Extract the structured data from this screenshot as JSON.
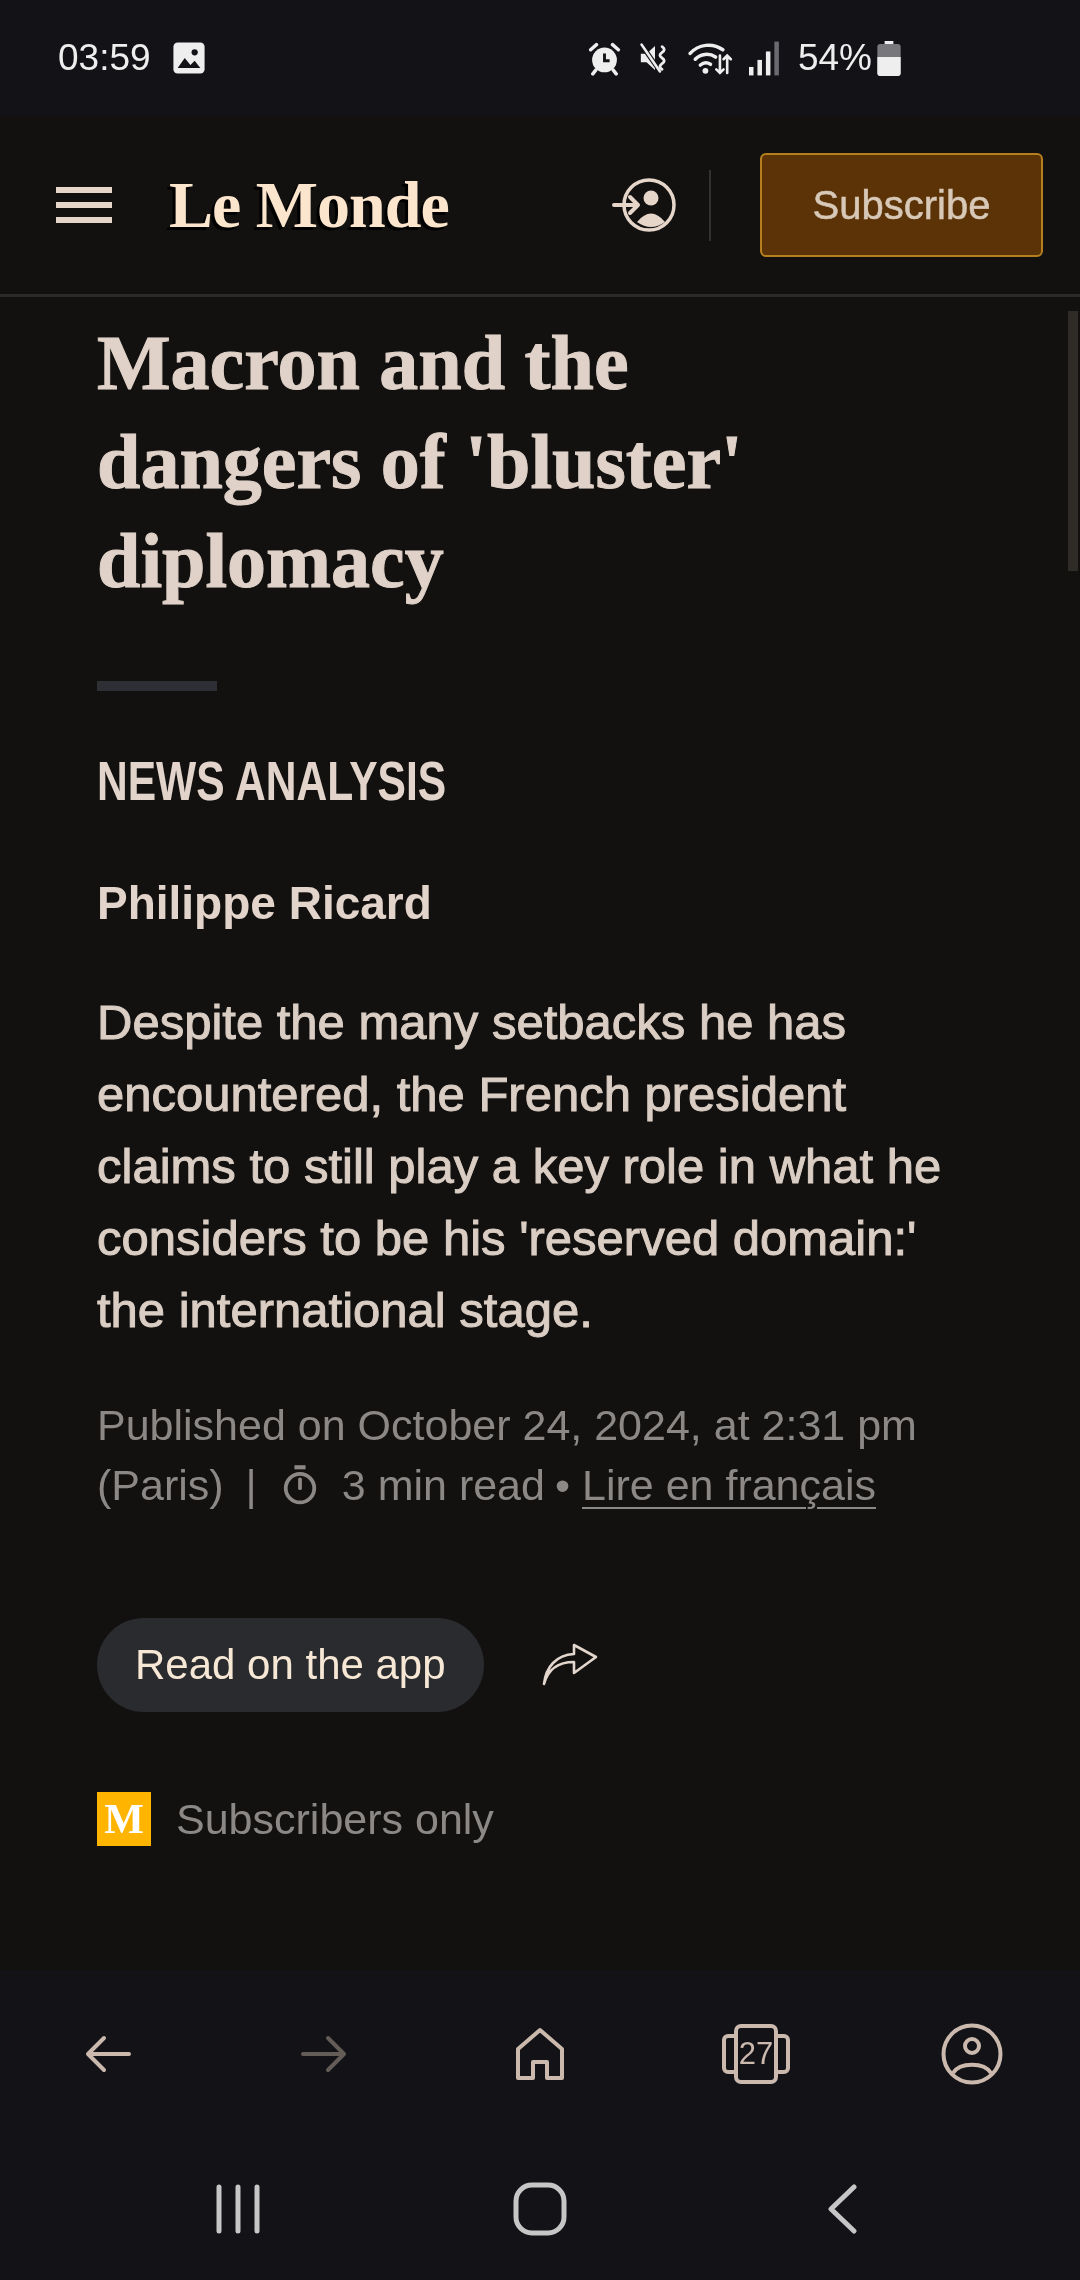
{
  "status_bar": {
    "time": "03:59",
    "battery": "54%"
  },
  "header": {
    "logo": "Le Monde",
    "subscribe_button": "Subscribe"
  },
  "article": {
    "title": "Macron and the dangers of 'bluster' diplomacy",
    "section": "NEWS ANALYSIS",
    "author": "Philippe Ricard",
    "summary": "Despite the many setbacks he has encountered, the French president claims to still play a key role in what he considers to be his 'reserved domain:' the international stage.",
    "meta": {
      "published": "Published on October 24, 2024, at 2:31 pm",
      "timezone": "(Paris)",
      "separator": "|",
      "read_time": "3 min read",
      "bullet": "•",
      "language_link": "Lire en français"
    },
    "read_on_app_button": "Read on the app",
    "access": {
      "badge": "M",
      "label": "Subscribers only"
    }
  },
  "browser_toolbar": {
    "items": [
      {
        "kind": "back",
        "disabled": false
      },
      {
        "kind": "forward",
        "disabled": true
      },
      {
        "kind": "home",
        "disabled": false
      },
      {
        "kind": "tabs",
        "count": "27",
        "disabled": false
      },
      {
        "kind": "account",
        "disabled": false
      }
    ]
  }
}
